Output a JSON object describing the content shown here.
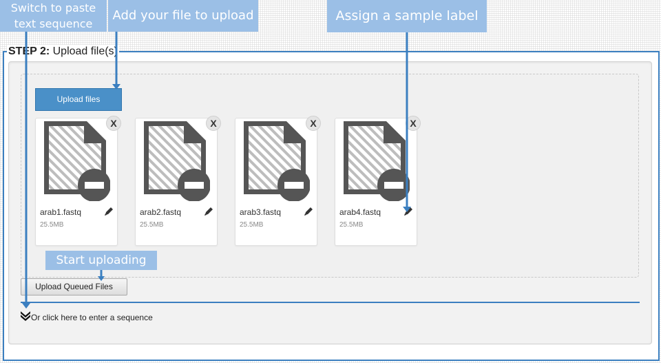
{
  "step": {
    "label": "STEP 2:",
    "title": " Upload file(s)"
  },
  "buttons": {
    "upload_files": "Upload files",
    "upload_queued": "Upload Queued Files"
  },
  "files": [
    {
      "name": "arab1.fastq",
      "size": "25.5MB",
      "remove": "X"
    },
    {
      "name": "arab2.fastq",
      "size": "25.5MB",
      "remove": "X"
    },
    {
      "name": "arab3.fastq",
      "size": "25.5MB",
      "remove": "X"
    },
    {
      "name": "arab4.fastq",
      "size": "25.5MB",
      "remove": "X"
    }
  ],
  "sequence_link": "Or click here to enter a sequence",
  "callouts": {
    "switch_line1": "Switch to paste",
    "switch_line2": "text sequence",
    "add_file": "Add your file to upload",
    "assign_label": "Assign a sample label",
    "start_uploading": "Start uploading"
  },
  "icons": {
    "file": "file-icon",
    "remove_badge": "minus-circle-icon",
    "edit": "pencil-icon",
    "expand": "double-chevron-down-icon"
  },
  "colors": {
    "accent": "#3b7fc0",
    "callout": "#9bbfe6",
    "button_primary": "#4a90c8",
    "file_icon": "#555555"
  }
}
